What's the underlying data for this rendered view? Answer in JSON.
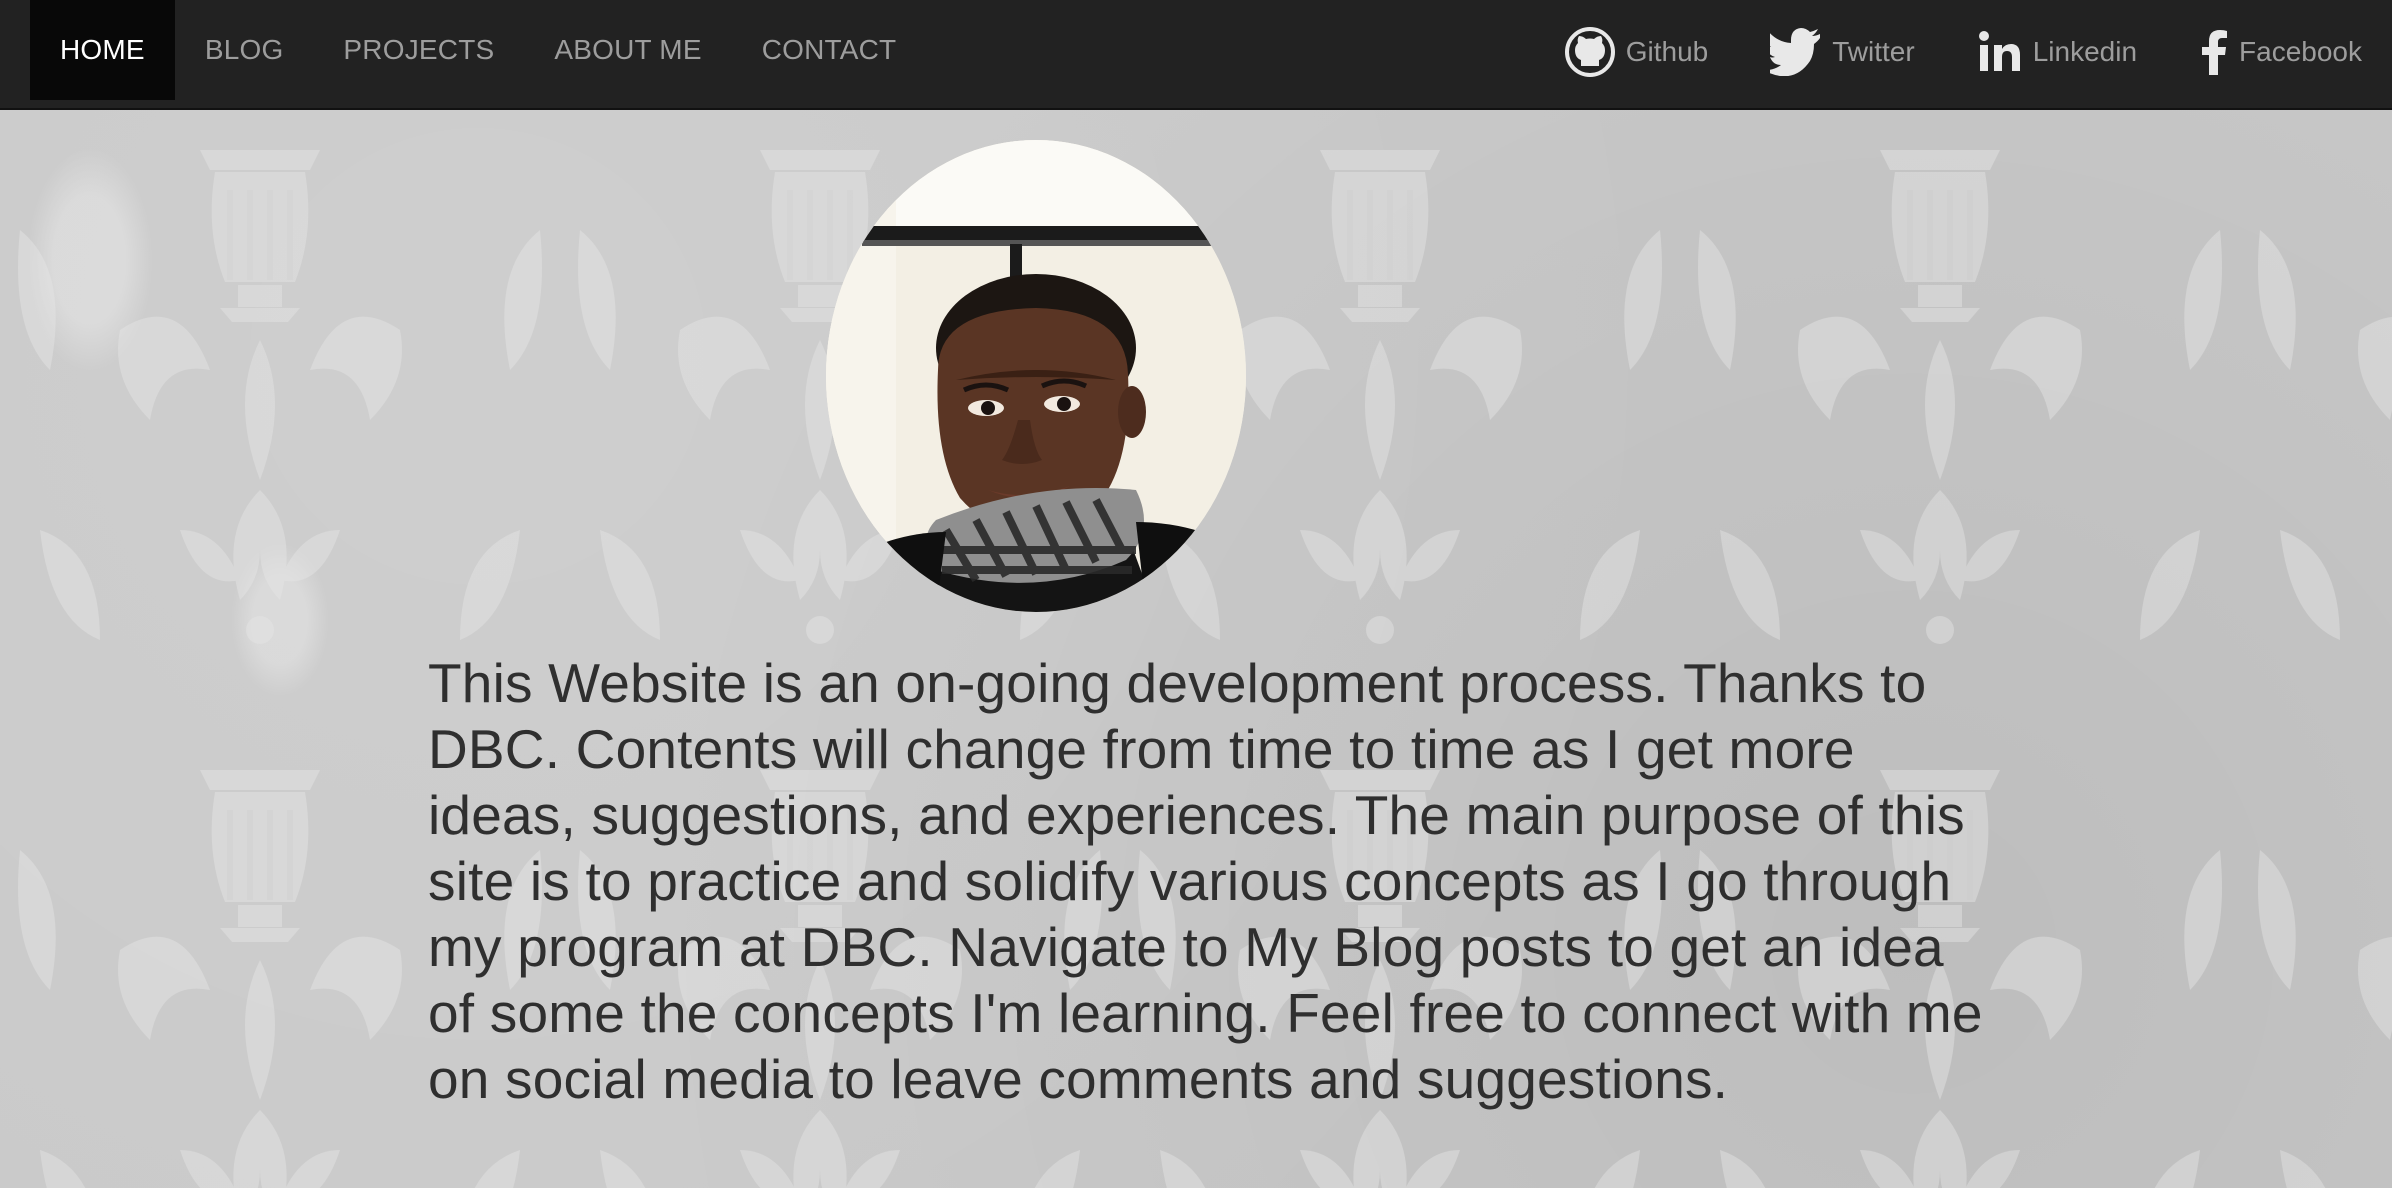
{
  "nav": {
    "items": [
      {
        "label": "HOME",
        "active": true
      },
      {
        "label": "BLOG",
        "active": false
      },
      {
        "label": "PROJECTS",
        "active": false
      },
      {
        "label": "ABOUT ME",
        "active": false
      },
      {
        "label": "CONTACT",
        "active": false
      }
    ]
  },
  "social": [
    {
      "label": "Github",
      "icon": "github-icon"
    },
    {
      "label": "Twitter",
      "icon": "twitter-icon"
    },
    {
      "label": "Linkedin",
      "icon": "linkedin-icon"
    },
    {
      "label": "Facebook",
      "icon": "facebook-icon"
    }
  ],
  "intro": {
    "text": "This Website is an on-going development process. Thanks to DBC. Contents will change from time to time as I get more ideas, suggestions, and experiences. The main purpose of this site is to practice and solidify various concepts as I go through my program at DBC. Navigate to My Blog posts to get an idea of some the concepts I'm learning. Feel free to connect with me on social media to leave comments and suggestions."
  },
  "colors": {
    "navbar_bg": "#222222",
    "nav_active_bg": "#080808",
    "nav_text": "#9d9d9d",
    "nav_active_text": "#ffffff",
    "body_text": "#2f2f2f",
    "page_bg": "#c9c9c9"
  }
}
